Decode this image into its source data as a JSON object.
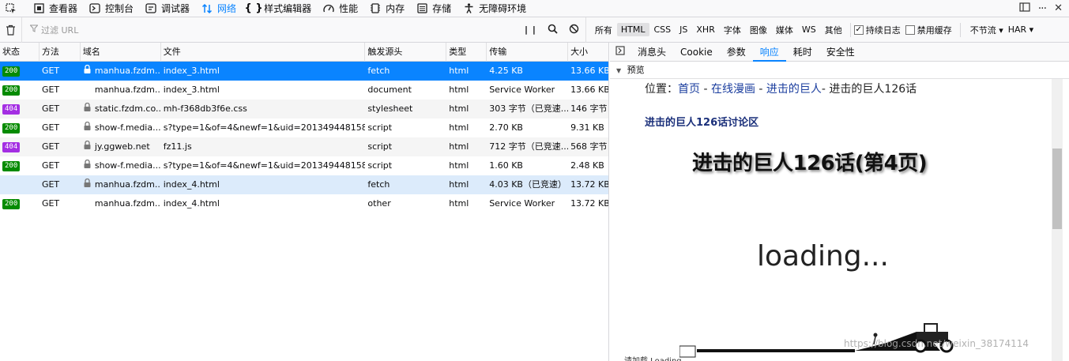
{
  "tabs": [
    {
      "label": "查看器",
      "icon": "inspector-icon",
      "active": false
    },
    {
      "label": "控制台",
      "icon": "console-icon",
      "active": false
    },
    {
      "label": "调试器",
      "icon": "debugger-icon",
      "active": false
    },
    {
      "label": "网络",
      "icon": "network-icon",
      "active": true
    },
    {
      "label": "样式编辑器",
      "icon": "style-editor-icon",
      "active": false
    },
    {
      "label": "性能",
      "icon": "performance-icon",
      "active": false
    },
    {
      "label": "内存",
      "icon": "memory-icon",
      "active": false
    },
    {
      "label": "存储",
      "icon": "storage-icon",
      "active": false
    },
    {
      "label": "无障碍环境",
      "icon": "accessibility-icon",
      "active": false
    }
  ],
  "toolbar": {
    "filter_placeholder": "过滤 URL",
    "types": [
      "所有",
      "HTML",
      "CSS",
      "JS",
      "XHR",
      "字体",
      "图像",
      "媒体",
      "WS",
      "其他"
    ],
    "active_type": "HTML",
    "persist_label": "持续日志",
    "persist_checked": true,
    "cache_label": "禁用缓存",
    "cache_checked": false,
    "throttle_label": "不节流 ▾",
    "har_label": "HAR ▾"
  },
  "columns": {
    "status": "状态",
    "method": "方法",
    "domain": "域名",
    "file": "文件",
    "cause": "触发源头",
    "type": "类型",
    "transferred": "传输",
    "size": "大小"
  },
  "requests": [
    {
      "status": "200",
      "method": "GET",
      "secure": true,
      "domain": "manhua.fzdm....",
      "file": "index_3.html",
      "cause": "fetch",
      "type": "html",
      "transferred": "4.25 KB",
      "size": "13.66 KB",
      "selected": true
    },
    {
      "status": "200",
      "method": "GET",
      "secure": false,
      "domain": "manhua.fzdm....",
      "file": "index_3.html",
      "cause": "document",
      "type": "html",
      "transferred": "Service Worker",
      "size": "13.66 KB"
    },
    {
      "status": "404",
      "method": "GET",
      "secure": true,
      "domain": "static.fzdm.co...",
      "file": "mh-f368db3f6e.css",
      "cause": "stylesheet",
      "type": "html",
      "transferred": "303 字节（已竞速...",
      "size": "146 字节"
    },
    {
      "status": "200",
      "method": "GET",
      "secure": true,
      "domain": "show-f.media...",
      "file": "s?type=1&of=4&newf=1&uid=201349448158...",
      "cause": "script",
      "type": "html",
      "transferred": "2.70 KB",
      "size": "9.31 KB"
    },
    {
      "status": "404",
      "method": "GET",
      "secure": true,
      "domain": "jy.ggweb.net",
      "file": "fz11.js",
      "cause": "script",
      "type": "html",
      "transferred": "712 字节（已竞速...",
      "size": "568 字节"
    },
    {
      "status": "200",
      "method": "GET",
      "secure": true,
      "domain": "show-f.media...",
      "file": "s?type=1&of=4&newf=1&uid=201349448158...",
      "cause": "script",
      "type": "html",
      "transferred": "1.60 KB",
      "size": "2.48 KB"
    },
    {
      "status": "",
      "method": "GET",
      "secure": true,
      "domain": "manhua.fzdm....",
      "file": "index_4.html",
      "cause": "fetch",
      "type": "html",
      "transferred": "4.03 KB（已竞速）",
      "size": "13.72 KB",
      "hovered": true
    },
    {
      "status": "200",
      "method": "GET",
      "secure": false,
      "domain": "manhua.fzdm....",
      "file": "index_4.html",
      "cause": "other",
      "type": "html",
      "transferred": "Service Worker",
      "size": "13.72 KB"
    }
  ],
  "panel": {
    "tabs": [
      "消息头",
      "Cookie",
      "参数",
      "响应",
      "耗时",
      "安全性"
    ],
    "active_tab": "响应",
    "preview_label": "预览",
    "crumb_prefix": "位置：",
    "crumb_home": "首页",
    "crumb_sep": " - ",
    "crumb_online": "在线漫画",
    "crumb_series": "进击的巨人",
    "crumb_tail": "- 进击的巨人126话",
    "discuss": "进击的巨人126话讨论区",
    "title": "进击的巨人126话(第4页)",
    "loading": "loading...",
    "watermark": "https://blog.csdn.net/weixin_38174114",
    "footer": "请加载 Loading..."
  }
}
